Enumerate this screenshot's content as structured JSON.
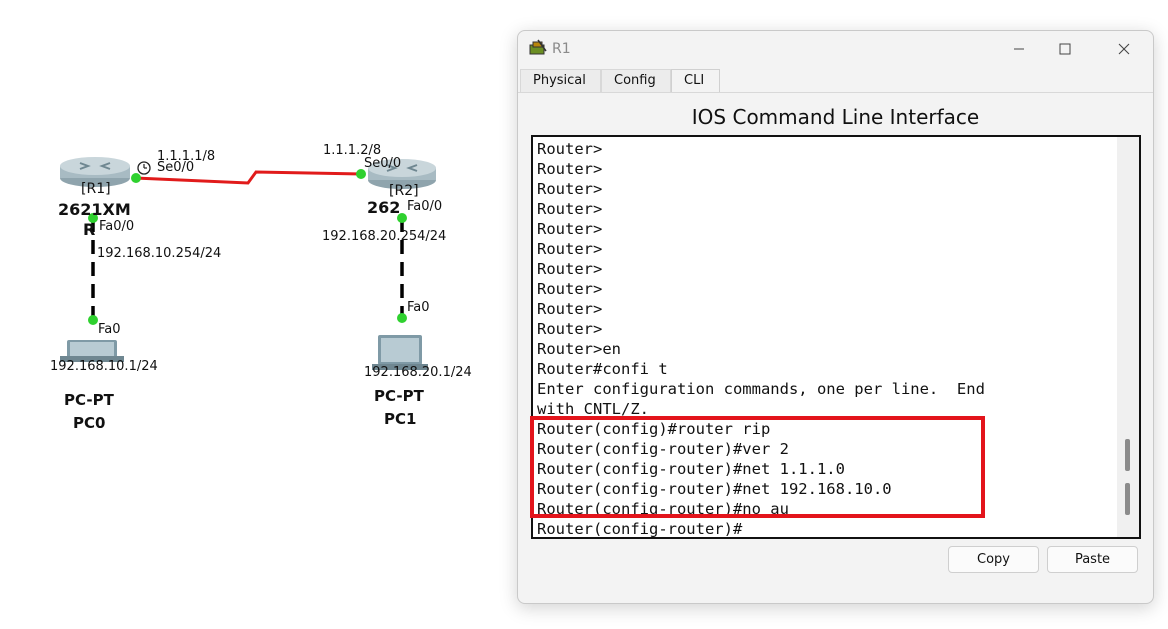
{
  "topology": {
    "r1": {
      "name": "[R1]",
      "model": "2621XM",
      "model_suffix": "R",
      "serial_ip": "1.1.1.1/8",
      "serial_port": "Se0/0",
      "fa_port": "Fa0/0",
      "fa_ip": "192.168.10.254/24"
    },
    "r2": {
      "name": "[R2]",
      "model": "262",
      "serial_ip": "1.1.1.2/8",
      "serial_port": "Se0/0",
      "fa_port": "Fa0/0",
      "fa_ip": "192.168.20.254/24"
    },
    "pc0": {
      "port": "Fa0",
      "ip": "192.168.10.1/24",
      "type": "PC-PT",
      "name": "PC0"
    },
    "pc1": {
      "port": "Fa0",
      "ip": "192.168.20.1/24",
      "type": "PC-PT",
      "name": "PC1"
    },
    "colors": {
      "serial_link": "#e11b1b",
      "link_light": "#2fd12f"
    }
  },
  "window": {
    "title": "R1",
    "tabs": [
      "Physical",
      "Config",
      "CLI"
    ],
    "active_tab": "CLI",
    "heading": "IOS Command Line Interface",
    "cli_lines": [
      "Router>",
      "Router>",
      "Router>",
      "Router>",
      "Router>",
      "Router>",
      "Router>",
      "Router>",
      "Router>",
      "Router>",
      "Router>en",
      "Router#confi t",
      "Enter configuration commands, one per line.  End",
      "with CNTL/Z.",
      "Router(config)#router rip",
      "Router(config-router)#ver 2",
      "Router(config-router)#net 1.1.1.0",
      "Router(config-router)#net 192.168.10.0",
      "Router(config-router)#no au",
      "Router(config-router)#"
    ],
    "copy_label": "Copy",
    "paste_label": "Paste",
    "highlight_color": "#e3141b"
  }
}
